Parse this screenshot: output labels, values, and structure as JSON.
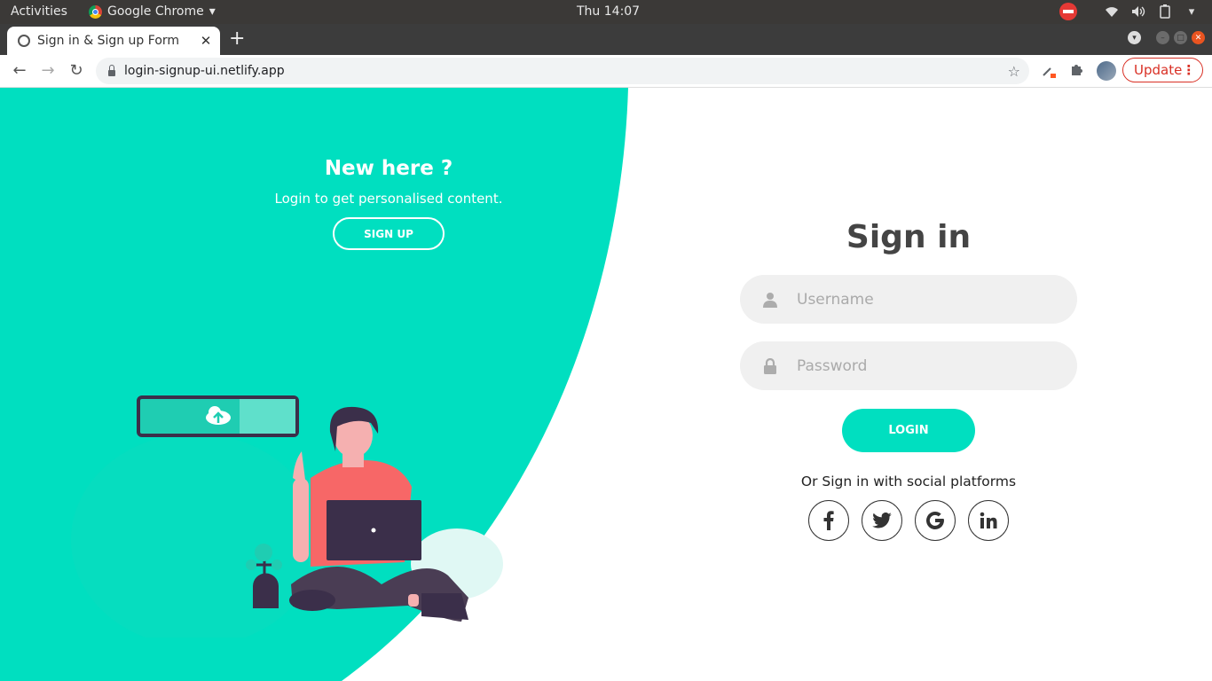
{
  "system_bar": {
    "activities": "Activities",
    "app_name": "Google Chrome",
    "clock": "Thu 14:07"
  },
  "browser": {
    "tab_title": "Sign in & Sign up Form",
    "url": "login-signup-ui.netlify.app",
    "update_label": "Update"
  },
  "left_panel": {
    "heading": "New here ?",
    "subtitle": "Login to get personalised content.",
    "signup_label": "SIGN UP"
  },
  "form": {
    "title": "Sign in",
    "username_placeholder": "Username",
    "password_placeholder": "Password",
    "login_label": "LOGIN",
    "social_text": "Or Sign in with social platforms",
    "social_icons": [
      "facebook-icon",
      "twitter-icon",
      "google-icon",
      "linkedin-icon"
    ]
  },
  "colors": {
    "accent": "#00dfc0",
    "title": "#444444",
    "input_bg": "#f0f0f0"
  }
}
